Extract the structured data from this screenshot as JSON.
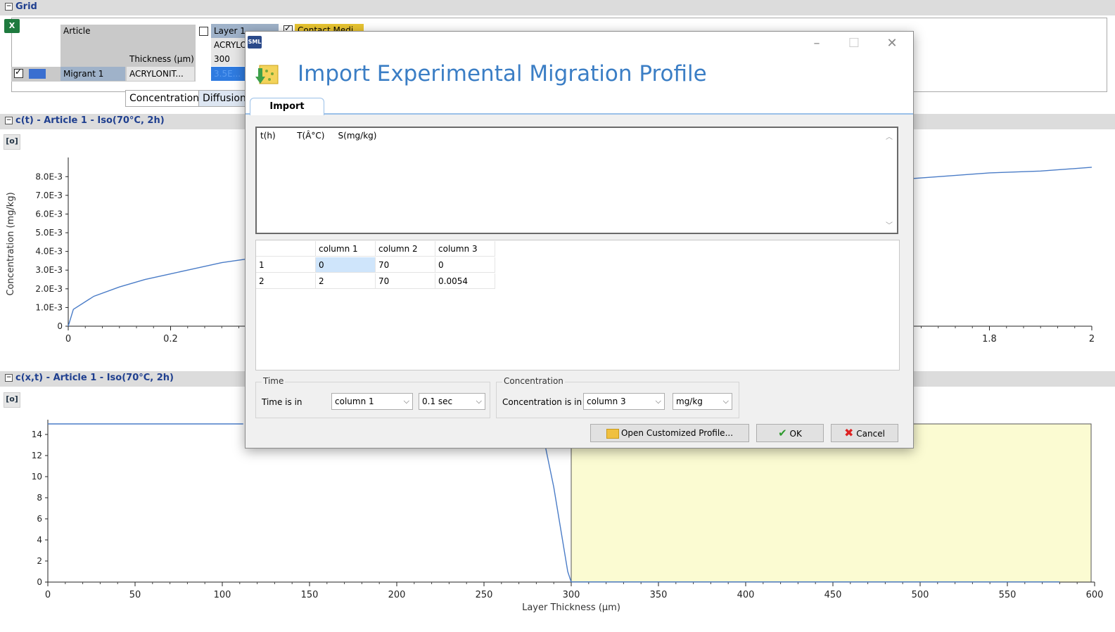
{
  "grid": {
    "section_title": "Grid",
    "excel_icon": "excel-icon",
    "rows": {
      "article": "Article",
      "layer_header": "Layer 1",
      "contact_header": "Contact Medi...",
      "layer_material": "ACRYLO",
      "thickness_label": "Thickness (μm)",
      "thickness_value": "300",
      "migrant_label": "Migrant 1",
      "migrant_material": "ACRYLONIT...",
      "migrant_value": "3.5E..."
    },
    "tabs": [
      "Concentration",
      "Diffusion"
    ],
    "colors": {
      "migrant_color": "#3a6fd0",
      "contact_color": "#e8c431"
    }
  },
  "chart1": {
    "section_title": "c(t) - Article 1 - Iso(70°C, 2h)",
    "camera_icon": "camera-icon"
  },
  "chart2": {
    "section_title": "c(x,t) - Article 1 - Iso(70°C, 2h)",
    "camera_icon": "camera-icon"
  },
  "chart_data": [
    {
      "type": "line",
      "title": "",
      "xlabel": "",
      "ylabel": "Concentration (mg/kg)",
      "x_ticks": [
        "0",
        "0.2",
        "1.8",
        "2"
      ],
      "y_ticks": [
        "0",
        "1.0E-3",
        "2.0E-3",
        "3.0E-3",
        "4.0E-3",
        "5.0E-3",
        "6.0E-3",
        "7.0E-3",
        "8.0E-3"
      ],
      "xlim": [
        0,
        2
      ],
      "ylim": [
        0,
        0.0088
      ],
      "series": [
        {
          "x": [
            0,
            0.01,
            0.05,
            0.1,
            0.15,
            0.2,
            0.25,
            0.3,
            0.35
          ],
          "y": [
            0,
            0.0009,
            0.0016,
            0.0021,
            0.0025,
            0.0028,
            0.0031,
            0.0034,
            0.0036
          ]
        },
        {
          "x": [
            1.65,
            1.7,
            1.8,
            1.9,
            2.0
          ],
          "y": [
            0.0079,
            0.008,
            0.0082,
            0.0083,
            0.0085
          ]
        }
      ],
      "line_color": "#4a7cc7"
    },
    {
      "type": "line",
      "title": "",
      "xlabel": "Layer Thickness (μm)",
      "ylabel": "Concentration (mg/kg)",
      "x_ticks": [
        "0",
        "50",
        "100",
        "150",
        "200",
        "250",
        "300",
        "350",
        "400",
        "450",
        "500",
        "550",
        "600"
      ],
      "y_ticks": [
        "0",
        "2",
        "4",
        "6",
        "8",
        "10",
        "12",
        "14"
      ],
      "xlim": [
        0,
        600
      ],
      "ylim": [
        0,
        15
      ],
      "series": [
        {
          "x": [
            0,
            112
          ],
          "y": [
            15,
            15
          ]
        },
        {
          "x": [
            285,
            290,
            295,
            298,
            300
          ],
          "y": [
            13,
            9,
            4,
            1,
            0
          ]
        },
        {
          "x": [
            300,
            580
          ],
          "y": [
            0.02,
            0.02
          ]
        }
      ],
      "region": {
        "x0": 300,
        "x1": 598,
        "y0": 0,
        "y1": 15,
        "color": "#fbfbd2"
      },
      "line_color": "#4a7cc7"
    }
  ],
  "dialog": {
    "app_icon": "sml-app-icon",
    "title": "Import Experimental Migration Profile",
    "header_icon": "import-profile-icon",
    "minimize": "–",
    "maximize": "☐",
    "close": "✕",
    "tab": "Import",
    "raw_text_header": "t(h)        T(Â°C)     S(mg/kg)",
    "table": {
      "headers": [
        "",
        "column 1",
        "column 2",
        "column 3"
      ],
      "rows": [
        [
          "1",
          "0",
          "70",
          "0"
        ],
        [
          "2",
          "2",
          "70",
          "0.0054"
        ]
      ]
    },
    "time_group": {
      "title": "Time",
      "label": "Time is in",
      "column_select": "column 1",
      "unit_select": "0.1 sec"
    },
    "conc_group": {
      "title": "Concentration",
      "label": "Concentration is in",
      "column_select": "column 3",
      "unit_select": "mg/kg"
    },
    "buttons": {
      "open_profile": "Open Customized Profile...",
      "ok": "OK",
      "cancel": "Cancel"
    }
  }
}
